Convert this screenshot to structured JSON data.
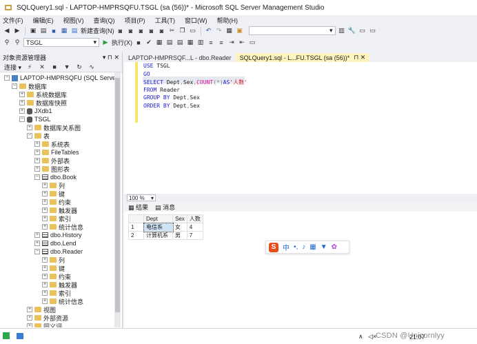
{
  "window": {
    "title": "SQLQuery1.sql - LAPTOP-HMPRSQFU.TSGL (sa (56))* - Microsoft SQL Server Management Studio"
  },
  "menu": [
    "文件(F)",
    "编辑(E)",
    "视图(V)",
    "查询(Q)",
    "项目(P)",
    "工具(T)",
    "窗口(W)",
    "帮助(H)"
  ],
  "toolbar1": {
    "new_query": "新建查询(N)"
  },
  "toolbar2": {
    "db_combo": "TSGL",
    "execute": "执行(X)"
  },
  "object_explorer": {
    "title": "对象资源管理器",
    "pin": "▾ ⊓ ✕",
    "connect": "连接 ▾",
    "tree": [
      {
        "label": "LAPTOP-HMPRSQFU (SQL Server",
        "type": "server",
        "exp": "−",
        "indent": 0
      },
      {
        "label": "数据库",
        "type": "folder",
        "exp": "−",
        "indent": 1
      },
      {
        "label": "系统数据库",
        "type": "folder",
        "exp": "+",
        "indent": 2
      },
      {
        "label": "数据库快照",
        "type": "folder",
        "exp": "+",
        "indent": 2
      },
      {
        "label": "JXdb1",
        "type": "db",
        "exp": "+",
        "indent": 2
      },
      {
        "label": "TSGL",
        "type": "db",
        "exp": "−",
        "indent": 2
      },
      {
        "label": "数据库关系图",
        "type": "folder",
        "exp": "+",
        "indent": 3
      },
      {
        "label": "表",
        "type": "folder",
        "exp": "−",
        "indent": 3
      },
      {
        "label": "系统表",
        "type": "folder",
        "exp": "+",
        "indent": 4
      },
      {
        "label": "FileTables",
        "type": "folder",
        "exp": "+",
        "indent": 4
      },
      {
        "label": "外部表",
        "type": "folder",
        "exp": "+",
        "indent": 4
      },
      {
        "label": "图形表",
        "type": "folder",
        "exp": "+",
        "indent": 4
      },
      {
        "label": "dbo.Book",
        "type": "table",
        "exp": "−",
        "indent": 4
      },
      {
        "label": "列",
        "type": "folder",
        "exp": "+",
        "indent": 5
      },
      {
        "label": "键",
        "type": "folder",
        "exp": "+",
        "indent": 5
      },
      {
        "label": "约束",
        "type": "folder",
        "exp": "+",
        "indent": 5
      },
      {
        "label": "触发器",
        "type": "folder",
        "exp": "+",
        "indent": 5
      },
      {
        "label": "索引",
        "type": "folder",
        "exp": "+",
        "indent": 5
      },
      {
        "label": "统计信息",
        "type": "folder",
        "exp": "+",
        "indent": 5
      },
      {
        "label": "dbo.History",
        "type": "table",
        "exp": "+",
        "indent": 4
      },
      {
        "label": "dbo.Lend",
        "type": "table",
        "exp": "+",
        "indent": 4
      },
      {
        "label": "dbo.Reader",
        "type": "table",
        "exp": "−",
        "indent": 4
      },
      {
        "label": "列",
        "type": "folder",
        "exp": "+",
        "indent": 5
      },
      {
        "label": "键",
        "type": "folder",
        "exp": "+",
        "indent": 5
      },
      {
        "label": "约束",
        "type": "folder",
        "exp": "+",
        "indent": 5
      },
      {
        "label": "触发器",
        "type": "folder",
        "exp": "+",
        "indent": 5
      },
      {
        "label": "索引",
        "type": "folder",
        "exp": "+",
        "indent": 5
      },
      {
        "label": "统计信息",
        "type": "folder",
        "exp": "+",
        "indent": 5
      },
      {
        "label": "视图",
        "type": "folder",
        "exp": "+",
        "indent": 3
      },
      {
        "label": "外部资源",
        "type": "folder",
        "exp": "+",
        "indent": 3
      },
      {
        "label": "同义词",
        "type": "folder",
        "exp": "+",
        "indent": 3
      }
    ]
  },
  "tabs": {
    "inactive": "LAPTOP-HMPRSQF...L - dbo.Reader",
    "active": "SQLQuery1.sql - L...FU.TSGL (sa (56))*",
    "active_controls": "⊓ ✕"
  },
  "editor": {
    "lines": [
      {
        "parts": [
          {
            "t": "USE ",
            "c": "kw"
          },
          {
            "t": "TSGL",
            "c": ""
          }
        ]
      },
      {
        "parts": [
          {
            "t": "GO",
            "c": "kw"
          }
        ]
      },
      {
        "parts": [
          {
            "t": "SELECT ",
            "c": "kw"
          },
          {
            "t": "Dept",
            "c": ""
          },
          {
            "t": ",",
            "c": "gry"
          },
          {
            "t": "Sex",
            "c": ""
          },
          {
            "t": ",",
            "c": "gry"
          },
          {
            "t": "COUNT",
            "c": "fn"
          },
          {
            "t": "(*)",
            "c": "gry"
          },
          {
            "t": "AS",
            "c": "kw"
          },
          {
            "t": "'人数'",
            "c": "str"
          }
        ]
      },
      {
        "parts": [
          {
            "t": "FROM ",
            "c": "kw"
          },
          {
            "t": "Reader",
            "c": ""
          }
        ]
      },
      {
        "parts": [
          {
            "t": "GROUP BY ",
            "c": "kw"
          },
          {
            "t": "Dept",
            "c": ""
          },
          {
            "t": ",",
            "c": "gry"
          },
          {
            "t": "Sex",
            "c": ""
          }
        ]
      },
      {
        "parts": [
          {
            "t": "ORDER BY ",
            "c": "kw"
          },
          {
            "t": "Dept",
            "c": ""
          },
          {
            "t": ",",
            "c": "gry"
          },
          {
            "t": "Sex",
            "c": ""
          }
        ]
      }
    ]
  },
  "zoom": "100 %",
  "results_tabs": {
    "results": "结果",
    "messages": "消息"
  },
  "results": {
    "columns": [
      "",
      "Dept",
      "Sex",
      "人数"
    ],
    "rows": [
      [
        "1",
        "电信系",
        "女",
        "4"
      ],
      [
        "2",
        "计算机系",
        "男",
        "7"
      ]
    ]
  },
  "ime": {
    "mode": "中"
  },
  "taskbar": {
    "time": "21:07",
    "watermark": "CSDN @Unicornlyy"
  }
}
